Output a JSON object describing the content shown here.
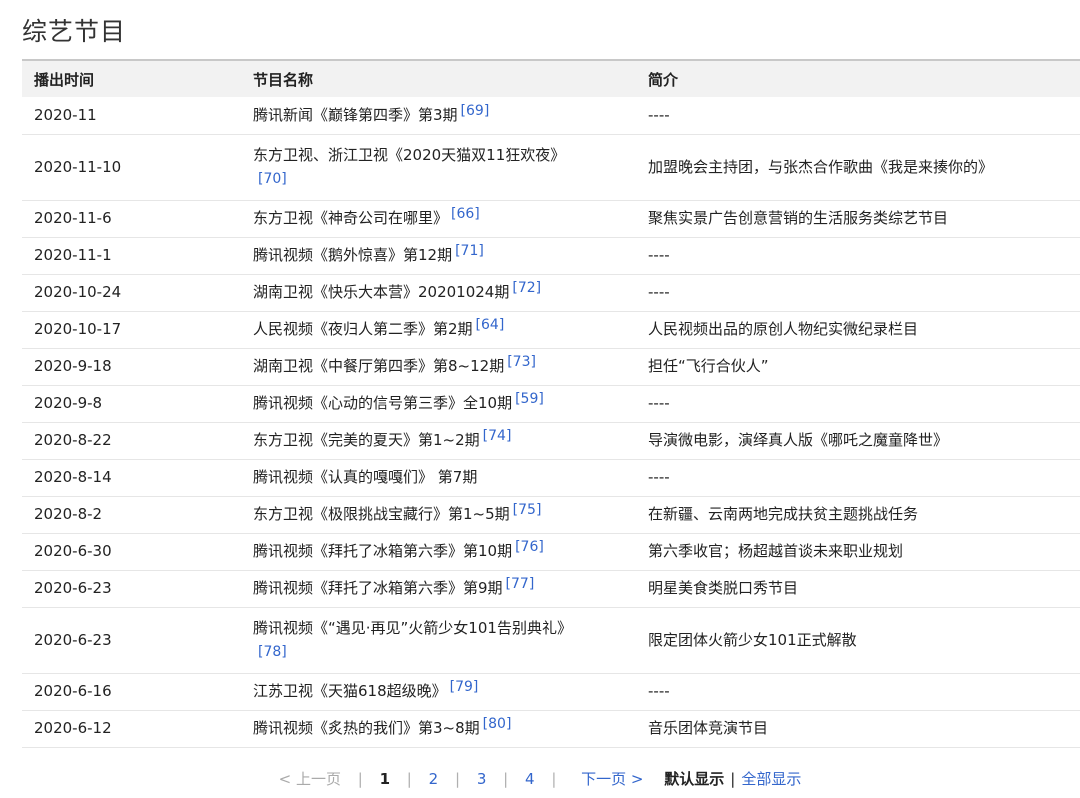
{
  "page": {
    "title": "综艺节目"
  },
  "table": {
    "headers": [
      "播出时间",
      "节目名称",
      "简介"
    ],
    "rows": [
      {
        "date": "2020-11",
        "name": "腾讯新闻《巅锋第四季》第3期",
        "ref": "[69]",
        "desc": "----",
        "tall": false
      },
      {
        "date": "2020-11-10",
        "name": "东方卫视、浙江卫视《2020天猫双11狂欢夜》",
        "ref": "[70]",
        "desc": "加盟晚会主持团，与张杰合作歌曲《我是来揍你的》",
        "tall": true
      },
      {
        "date": "2020-11-6",
        "name": "东方卫视《神奇公司在哪里》",
        "ref": "[66]",
        "desc": "聚焦实景广告创意营销的生活服务类综艺节目",
        "tall": false
      },
      {
        "date": "2020-11-1",
        "name": "腾讯视频《鹅外惊喜》第12期",
        "ref": "[71]",
        "desc": "----",
        "tall": false
      },
      {
        "date": "2020-10-24",
        "name": "湖南卫视《快乐大本营》20201024期",
        "ref": "[72]",
        "desc": "----",
        "tall": false
      },
      {
        "date": "2020-10-17",
        "name": "人民视频《夜归人第二季》第2期",
        "ref": "[64]",
        "desc": "人民视频出品的原创人物纪实微纪录栏目",
        "tall": false
      },
      {
        "date": "2020-9-18",
        "name": "湖南卫视《中餐厅第四季》第8~12期",
        "ref": "[73]",
        "desc": "担任“飞行合伙人”",
        "tall": false
      },
      {
        "date": "2020-9-8",
        "name": "腾讯视频《心动的信号第三季》全10期",
        "ref": "[59]",
        "desc": "----",
        "tall": false
      },
      {
        "date": "2020-8-22",
        "name": "东方卫视《完美的夏天》第1~2期",
        "ref": "[74]",
        "desc": "导演微电影，演绎真人版《哪吒之魔童降世》",
        "tall": false
      },
      {
        "date": "2020-8-14",
        "name": "腾讯视频《认真的嘎嘎们》 第7期",
        "ref": "",
        "desc": "----",
        "tall": false
      },
      {
        "date": "2020-8-2",
        "name": "东方卫视《极限挑战宝藏行》第1~5期",
        "ref": "[75]",
        "desc": "在新疆、云南两地完成扶贫主题挑战任务",
        "tall": false
      },
      {
        "date": "2020-6-30",
        "name": "腾讯视频《拜托了冰箱第六季》第10期",
        "ref": "[76]",
        "desc": "第六季收官；杨超越首谈未来职业规划",
        "tall": false
      },
      {
        "date": "2020-6-23",
        "name": "腾讯视频《拜托了冰箱第六季》第9期",
        "ref": "[77]",
        "desc": "明星美食类脱口秀节目",
        "tall": false
      },
      {
        "date": "2020-6-23",
        "name": "腾讯视频《“遇见·再见”火箭少女101告别典礼》",
        "ref": "[78]",
        "desc": "限定团体火箭少女101正式解散",
        "tall": true
      },
      {
        "date": "2020-6-16",
        "name": "江苏卫视《天猫618超级晚》",
        "ref": "[79]",
        "desc": "----",
        "tall": false
      },
      {
        "date": "2020-6-12",
        "name": "腾讯视频《炙热的我们》第3~8期",
        "ref": "[80]",
        "desc": "音乐团体竞演节目",
        "tall": false
      }
    ]
  },
  "pager": {
    "prev": "< 上一页",
    "pages": [
      "1",
      "2",
      "3",
      "4"
    ],
    "current": "1",
    "sep": "|",
    "next": "下一页 >",
    "mode_default": "默认显示",
    "mode_sep": "|",
    "mode_all": "全部显示"
  },
  "colors": {
    "link": "#3366cc",
    "header_bg": "#f2f2f2",
    "disabled": "#aaaaaa"
  }
}
